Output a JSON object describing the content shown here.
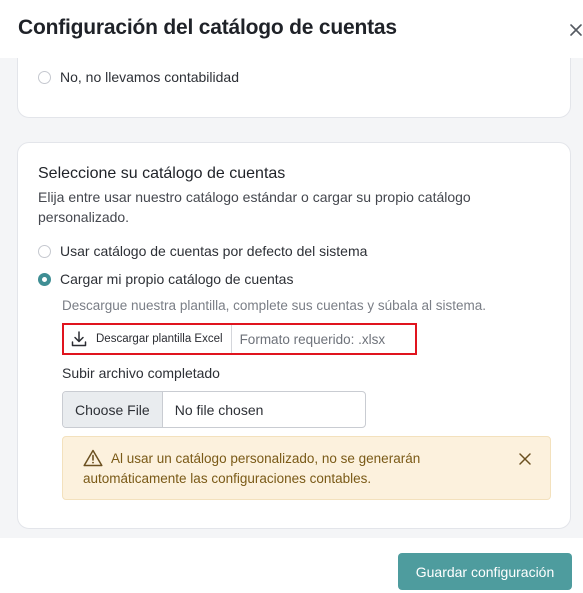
{
  "modal": {
    "title": "Configuración del catálogo de cuentas"
  },
  "accounting_card": {
    "option_no": "No, no llevamos contabilidad"
  },
  "catalog_card": {
    "title": "Seleccione su catálogo de cuentas",
    "description": "Elija entre usar nuestro catálogo estándar o cargar su propio catálogo personalizado.",
    "option_default": "Usar catálogo de cuentas por defecto del sistema",
    "option_custom": "Cargar mi propio catálogo de cuentas",
    "selected_option": "option_custom",
    "hint": "Descargue nuestra plantilla, complete sus cuentas y súbala al sistema.",
    "download_label": "Descargar plantilla Excel",
    "format_label": "Formato requerido: .xlsx",
    "upload_label": "Subir archivo completado",
    "choose_file_label": "Choose File",
    "no_file_label": "No file chosen",
    "warning_text": "Al usar un catálogo personalizado, no se generarán automáticamente las configuraciones contables."
  },
  "footer": {
    "save_label": "Guardar configuración"
  },
  "colors": {
    "accent": "#4e9c9e",
    "radio_checked": "#3f8e94",
    "highlight_border": "#e0141e",
    "warning_bg": "#fcf1dd",
    "warning_text": "#7a5a17"
  },
  "icons": {
    "close": "close-icon",
    "download": "download-icon",
    "warning": "warning-triangle-icon",
    "warning_close": "close-icon"
  }
}
